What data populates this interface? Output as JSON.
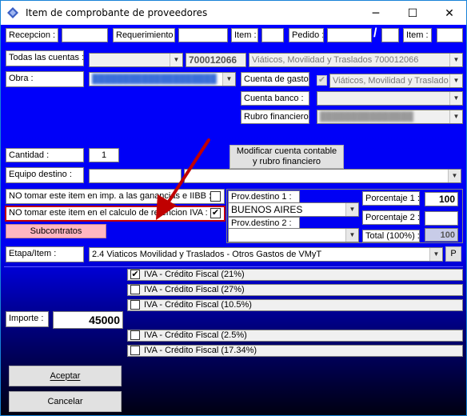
{
  "window": {
    "title": "Item de comprobante de proveedores",
    "minimize": "─",
    "maximize": "☐",
    "close": "✕"
  },
  "row1": {
    "recepcion_label": "Recepcion :",
    "recepcion_value": "",
    "requerimiento_label": "Requerimiento :",
    "requerimiento_value": "",
    "item_label": "Item :",
    "item_value": "",
    "pedido_label": "Pedido :",
    "pedido_value": "",
    "pedido_sep": "/",
    "pedido_value2": "",
    "item2_label": "Item :",
    "item2_value": ""
  },
  "cuentas": {
    "label": "Todas las cuentas :",
    "select_value": "",
    "code": "700012066",
    "description": "Viáticos, Movilidad y Traslados 700012066"
  },
  "obra": {
    "label": "Obra :",
    "value": "████████████████████"
  },
  "cuenta_gasto": {
    "label": "Cuenta de gasto :",
    "checked": true,
    "value": "Viáticos, Movilidad y Traslado"
  },
  "cuenta_banco": {
    "label": "Cuenta banco :",
    "value": ""
  },
  "rubro_financiero": {
    "label": "Rubro financiero :",
    "value": "███████████████"
  },
  "cantidad": {
    "label": "Cantidad :",
    "value": "1"
  },
  "modificar_button": "Modificar cuenta contable y rubro financiero",
  "equipo": {
    "label": "Equipo destino :",
    "value1": "",
    "value2": ""
  },
  "checks": {
    "no_ganancias_label": "NO tomar este item en imp. a las ganancias e IIBB :",
    "no_ganancias_checked": false,
    "no_iva_label": "NO tomar este item en el calculo de retencion IVA :",
    "no_iva_checked": true
  },
  "subcontratos_button": "Subcontratos",
  "prov": {
    "destino1_label": "Prov.destino 1 :",
    "destino1_value": "BUENOS AIRES",
    "destino2_label": "Prov.destino 2 :",
    "destino2_value": "",
    "porcentaje1_label": "Porcentaje 1 :",
    "porcentaje1_value": "100",
    "porcentaje2_label": "Porcentaje 2 :",
    "porcentaje2_value": "",
    "total_label": "Total (100%) :",
    "total_value": "100"
  },
  "etapa": {
    "label": "Etapa/Item :",
    "value": "2.4 Viaticos Movilidad y Traslados - Otros Gastos de VMyT",
    "p_button": "P"
  },
  "importe": {
    "label": "Importe :",
    "value": "45000"
  },
  "iva_items": [
    {
      "label": "IVA - Crédito Fiscal (21%)",
      "checked": true
    },
    {
      "label": "IVA - Crédito Fiscal (27%)",
      "checked": false
    },
    {
      "label": "IVA - Crédito Fiscal (10.5%)",
      "checked": false
    },
    {
      "label": "IVA - Crédito Fiscal (2.5%)",
      "checked": false
    },
    {
      "label": "IVA - Crédito Fiscal (17.34%)",
      "checked": false
    }
  ],
  "aceptar_button": "Aceptar",
  "cancelar_button": "Cancelar",
  "colors": {
    "background_top": "#0000ff",
    "background_bottom": "#000010",
    "highlight_border": "#c00000",
    "arrow": "#c00000",
    "subcontratos_bg": "#ffb6c1"
  }
}
